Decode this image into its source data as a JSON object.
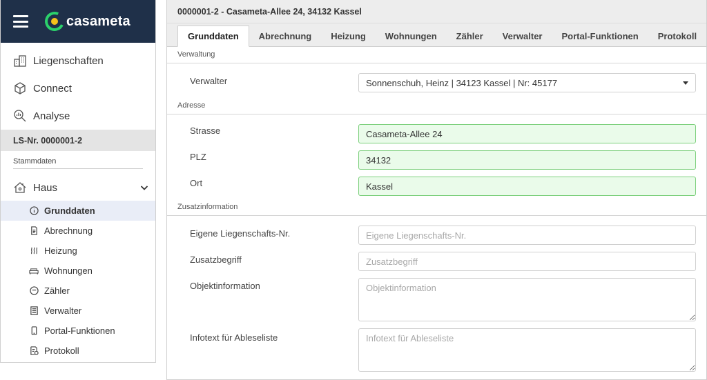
{
  "brand": {
    "name": "casameta"
  },
  "sidebar": {
    "main_items": [
      {
        "label": "Liegenschaften",
        "icon": "buildings-icon"
      },
      {
        "label": "Connect",
        "icon": "cube-icon"
      },
      {
        "label": "Analyse",
        "icon": "magnifier-chart-icon"
      }
    ],
    "ls_number": "LS-Nr. 0000001-2",
    "section_label": "Stammdaten",
    "haus_label": "Haus",
    "sub_items": [
      {
        "label": "Grunddaten",
        "icon": "info-icon",
        "active": true
      },
      {
        "label": "Abrechnung",
        "icon": "document-icon"
      },
      {
        "label": "Heizung",
        "icon": "heat-icon"
      },
      {
        "label": "Wohnungen",
        "icon": "sofa-icon"
      },
      {
        "label": "Zähler",
        "icon": "meter-icon"
      },
      {
        "label": "Verwalter",
        "icon": "list-icon"
      },
      {
        "label": "Portal-Funktionen",
        "icon": "phone-icon"
      },
      {
        "label": "Protokoll",
        "icon": "log-icon"
      }
    ]
  },
  "main": {
    "title": "0000001-2 - Casameta-Allee 24, 34132 Kassel",
    "tabs": [
      "Grunddaten",
      "Abrechnung",
      "Heizung",
      "Wohnungen",
      "Zähler",
      "Verwalter",
      "Portal-Funktionen",
      "Protokoll"
    ],
    "active_tab": "Grunddaten",
    "verwaltung": {
      "label": "Verwaltung",
      "verwalter_label": "Verwalter",
      "verwalter_value": "Sonnenschuh, Heinz | 34123 Kassel | Nr: 45177"
    },
    "adresse": {
      "label": "Adresse",
      "strasse_label": "Strasse",
      "strasse_value": "Casameta-Allee 24",
      "plz_label": "PLZ",
      "plz_value": "34132",
      "ort_label": "Ort",
      "ort_value": "Kassel"
    },
    "zusatz": {
      "label": "Zusatzinformation",
      "eigene_label": "Eigene Liegenschafts-Nr.",
      "eigene_placeholder": "Eigene Liegenschafts-Nr.",
      "zusatzbegriff_label": "Zusatzbegriff",
      "zusatzbegriff_placeholder": "Zusatzbegriff",
      "objekt_label": "Objektinformation",
      "objekt_placeholder": "Objektinformation",
      "infotext_label": "Infotext für Ableseliste",
      "infotext_placeholder": "Infotext für Ableseliste"
    }
  },
  "colors": {
    "brandbar": "#1f3049",
    "accent_green": "#2bd06b",
    "accent_yellow": "#f5c21b",
    "filled_bg": "#eafbea",
    "active_bg": "#e9edf7"
  }
}
